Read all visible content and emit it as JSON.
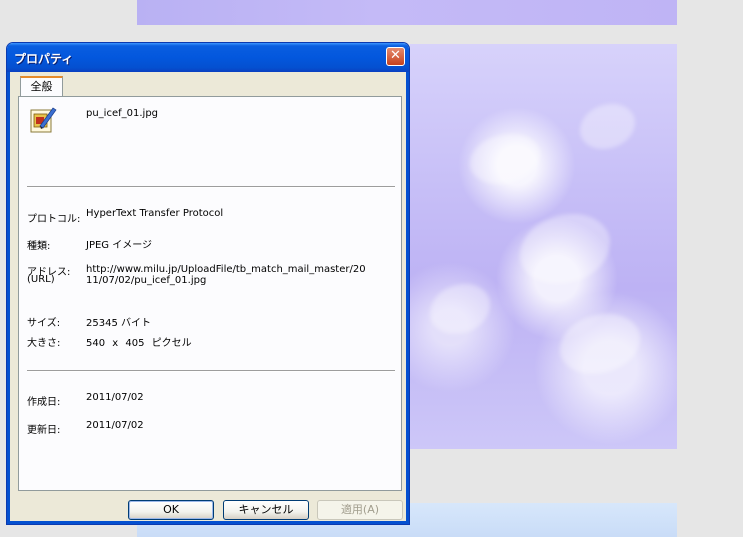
{
  "dialog": {
    "title": "プロパティ",
    "close_glyph": "✕",
    "tab_general": "全般",
    "file_name": "pu_icef_01.jpg",
    "fields": {
      "protocol_label": "プロトコル:",
      "protocol_value": "HyperText Transfer Protocol",
      "type_label": "種類:",
      "type_value": "JPEG イメージ",
      "address_label_1": "アドレス:",
      "address_label_2": "(URL)",
      "address_value_1": "http://www.milu.jp/UploadFile/tb_match_mail_master/20",
      "address_value_2": "11/07/02/pu_icef_01.jpg",
      "size_label": "サイズ:",
      "size_value": "25345 バイト",
      "dimensions_label": "大きさ:",
      "dimensions_value": "540 x 405 ピクセル",
      "created_label": "作成日:",
      "created_value": "2011/07/02",
      "modified_label": "更新日:",
      "modified_value": "2011/07/02"
    },
    "buttons": {
      "ok": "OK",
      "cancel": "キャンセル",
      "apply": "適用(A)"
    },
    "icons": {
      "file": "jpeg-image-file-icon",
      "close": "close-icon"
    }
  },
  "colors": {
    "titlebar": "#0357dd",
    "dialog_bg": "#ece9d8",
    "tab_highlight": "#e68b2c",
    "page_bg": "#e6e6e6",
    "image_tint": "#c7bff7"
  }
}
